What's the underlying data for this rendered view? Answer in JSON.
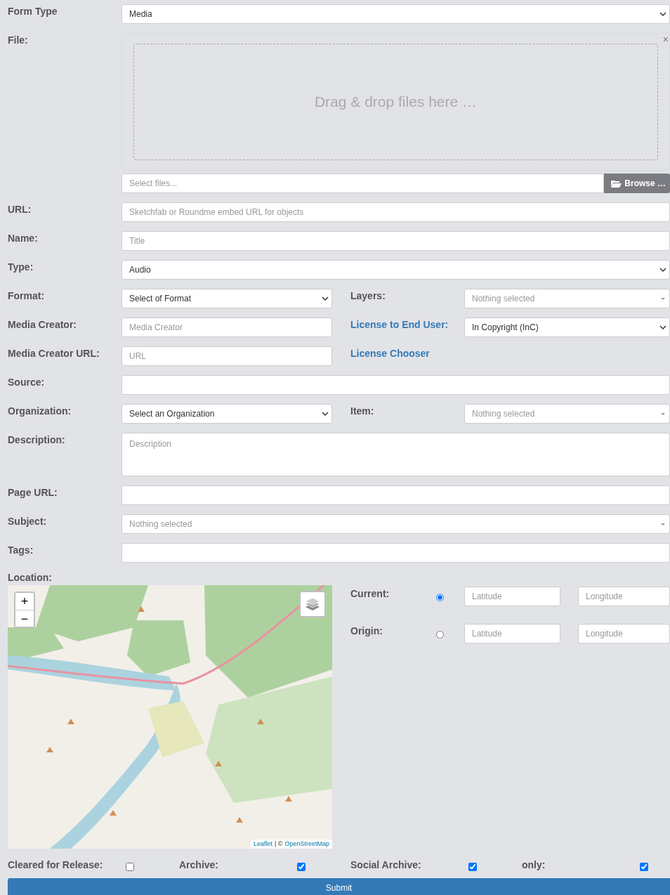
{
  "rows": [
    {
      "kind": "select",
      "label": "Form Type",
      "value": "Media"
    },
    {
      "kind": "file",
      "label": "File:",
      "dropzone": "Drag & drop files here …",
      "placeholder": "Select files...",
      "button": "Browse …",
      "close": "×"
    },
    {
      "kind": "text",
      "label": "URL:",
      "placeholder": "Sketchfab or Roundme embed URL for objects"
    },
    {
      "kind": "text",
      "label": "Name:",
      "placeholder": "Title"
    },
    {
      "kind": "select",
      "label": "Type:",
      "value": "Audio"
    },
    {
      "kind": "split",
      "left": {
        "kind": "select",
        "label": "Format:",
        "value": "Select of Format"
      },
      "right": {
        "kind": "multiselect",
        "label": "Layers:",
        "placeholder": "Nothing selected"
      }
    },
    {
      "kind": "split",
      "left": {
        "kind": "text",
        "label": "Media Creator:",
        "placeholder": "Media Creator"
      },
      "right": {
        "kind": "select",
        "label": "License to End User:",
        "link": true,
        "value": "In Copyright (InC)"
      }
    },
    {
      "kind": "split",
      "left": {
        "kind": "text",
        "label": "Media Creator URL:",
        "placeholder": "URL"
      },
      "right": {
        "kind": "none",
        "label": "License Chooser",
        "link": true
      }
    },
    {
      "kind": "text",
      "label": "Source:"
    },
    {
      "kind": "split",
      "left": {
        "kind": "select",
        "label": "Organization:",
        "value": "Select an Organization"
      },
      "right": {
        "kind": "multiselect",
        "label": "Item:",
        "placeholder": "Nothing selected"
      }
    },
    {
      "kind": "textarea",
      "label": "Description:",
      "placeholder": "Description"
    },
    {
      "kind": "text",
      "label": "Page URL:"
    },
    {
      "kind": "multiselect",
      "label": "Subject:",
      "placeholder": "Nothing selected"
    },
    {
      "kind": "text",
      "label": "Tags:"
    }
  ],
  "location": {
    "label": "Location:",
    "map": {
      "kind": "picture",
      "zoom_in": "+",
      "zoom_out": "−",
      "attribution_link": "Leaflet",
      "attribution_sep": "| ©",
      "attribution_osm": "OpenStreetMap"
    },
    "points": [
      {
        "label": "Current:",
        "selected": true,
        "lat_placeholder": "Latitude",
        "lng_placeholder": "Longitude"
      },
      {
        "label": "Origin:",
        "selected": false,
        "lat_placeholder": "Latitude",
        "lng_placeholder": "Longitude"
      }
    ]
  },
  "checkboxes": [
    {
      "label": "Cleared for Release:",
      "checked": false
    },
    {
      "label": "Archive:",
      "checked": true
    },
    {
      "label": "Social Archive:",
      "checked": true
    },
    {
      "label": "only:",
      "checked": true
    }
  ],
  "submit": "Submit"
}
